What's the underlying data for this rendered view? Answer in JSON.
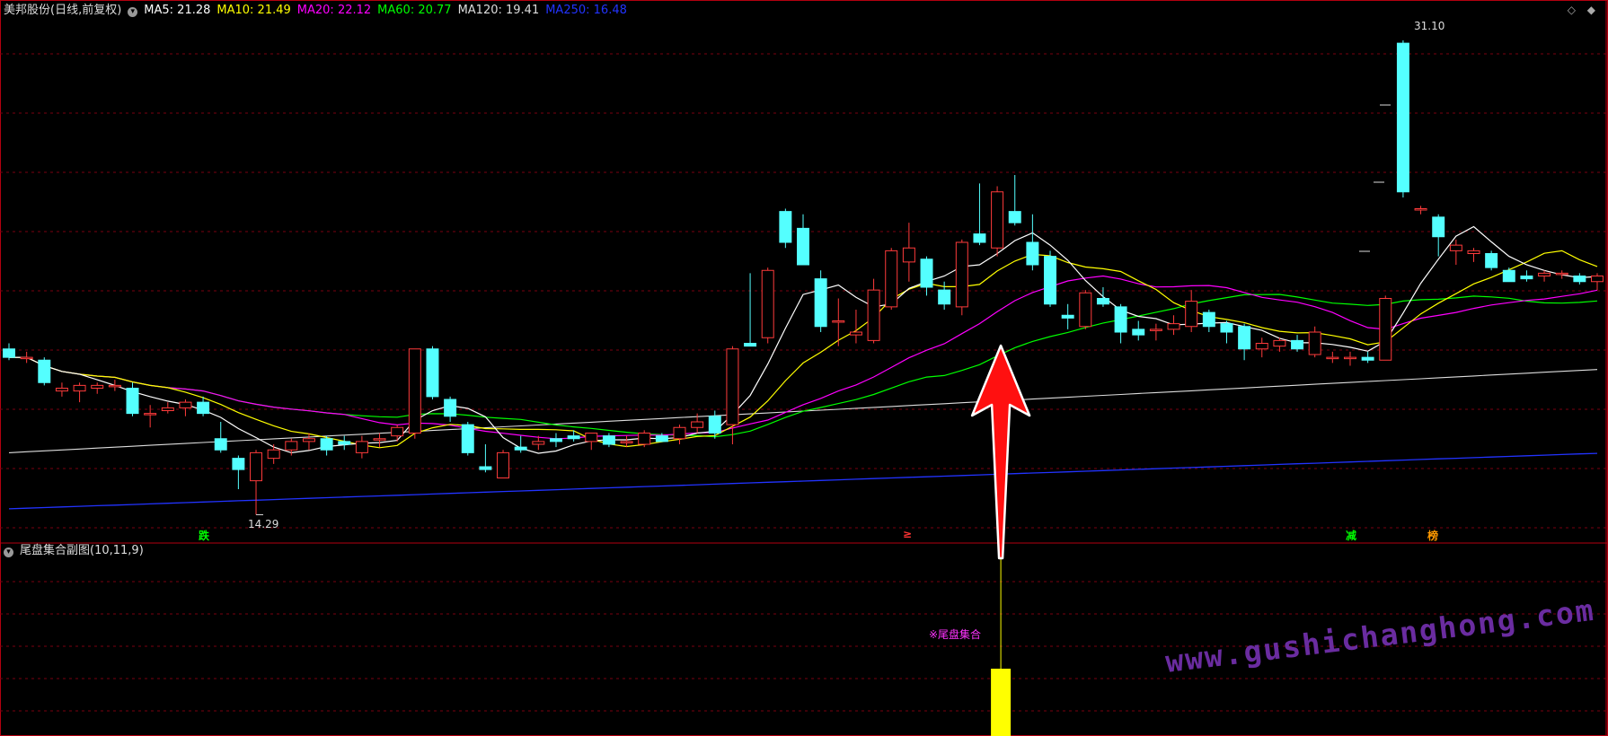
{
  "stock": {
    "title": "美邦股份(日线,前复权)"
  },
  "ma_legend": [
    {
      "label": "MA5: 21.28",
      "color": "#ffffff"
    },
    {
      "label": "MA10: 21.49",
      "color": "#ffff00"
    },
    {
      "label": "MA20: 22.12",
      "color": "#ff00ff"
    },
    {
      "label": "MA60: 20.77",
      "color": "#00ff00"
    },
    {
      "label": "MA120: 19.41",
      "color": "#dddddd"
    },
    {
      "label": "MA250: 16.48",
      "color": "#2233ff"
    }
  ],
  "price_labels": {
    "high": "31.10",
    "low": "14.29"
  },
  "signal_markers": [
    {
      "text": "跌",
      "color": "#00ff00"
    },
    {
      "text": "≥",
      "color": "#ff3333"
    },
    {
      "text": "减",
      "color": "#00ff00"
    },
    {
      "text": "榜",
      "color": "#ff9900"
    }
  ],
  "sub_panel": {
    "title": "尾盘集合副图(10,11,9)",
    "signal_label": "※尾盘集合"
  },
  "watermark": "www.gushichanghong.com",
  "icons": {
    "collapse": "chevron-down-icon",
    "diamond": "diamond-icon"
  },
  "chart_data": {
    "type": "candlestick",
    "candles": [
      [
        20.2,
        20.4,
        19.8,
        19.9
      ],
      [
        19.9,
        20.1,
        19.7,
        19.9
      ],
      [
        19.8,
        19.9,
        18.9,
        19.0
      ],
      [
        18.7,
        19.0,
        18.5,
        18.8
      ],
      [
        18.7,
        19.0,
        18.3,
        18.9
      ],
      [
        18.8,
        19.0,
        18.6,
        18.9
      ],
      [
        18.9,
        19.1,
        18.7,
        18.9
      ],
      [
        18.8,
        19.0,
        17.8,
        17.9
      ],
      [
        17.9,
        18.2,
        17.4,
        17.9
      ],
      [
        18.0,
        18.3,
        17.9,
        18.1
      ],
      [
        18.1,
        18.4,
        17.8,
        18.3
      ],
      [
        18.3,
        18.5,
        17.8,
        17.9
      ],
      [
        17.0,
        17.6,
        16.5,
        16.6
      ],
      [
        16.3,
        16.4,
        15.2,
        15.9
      ],
      [
        15.5,
        16.6,
        14.29,
        16.5
      ],
      [
        16.3,
        16.8,
        16.1,
        16.6
      ],
      [
        16.6,
        17.0,
        16.4,
        16.9
      ],
      [
        16.9,
        17.2,
        16.6,
        17.0
      ],
      [
        17.0,
        17.1,
        16.4,
        16.6
      ],
      [
        16.9,
        17.1,
        16.6,
        16.8
      ],
      [
        16.5,
        17.1,
        16.3,
        16.9
      ],
      [
        17.0,
        17.2,
        16.7,
        17.0
      ],
      [
        17.1,
        17.5,
        16.9,
        17.4
      ],
      [
        17.2,
        20.2,
        17.0,
        20.2
      ],
      [
        20.2,
        20.3,
        18.4,
        18.5
      ],
      [
        18.4,
        18.5,
        17.6,
        17.8
      ],
      [
        17.5,
        17.6,
        16.4,
        16.5
      ],
      [
        16.0,
        16.8,
        15.8,
        15.9
      ],
      [
        15.6,
        16.6,
        15.6,
        16.5
      ],
      [
        16.7,
        17.1,
        16.5,
        16.6
      ],
      [
        16.8,
        17.1,
        16.6,
        16.9
      ],
      [
        17.0,
        17.2,
        16.7,
        16.9
      ],
      [
        17.1,
        17.3,
        16.9,
        17.0
      ],
      [
        16.9,
        17.2,
        16.6,
        17.2
      ],
      [
        17.1,
        17.2,
        16.7,
        16.8
      ],
      [
        16.9,
        17.1,
        16.7,
        16.9
      ],
      [
        16.8,
        17.3,
        16.7,
        17.2
      ],
      [
        17.1,
        17.2,
        16.9,
        16.9
      ],
      [
        17.0,
        17.5,
        16.8,
        17.4
      ],
      [
        17.4,
        17.9,
        17.2,
        17.6
      ],
      [
        17.8,
        18.0,
        17.0,
        17.2
      ],
      [
        17.5,
        20.3,
        16.8,
        20.2
      ],
      [
        20.4,
        22.9,
        20.3,
        20.3
      ],
      [
        20.6,
        23.1,
        20.4,
        23.0
      ],
      [
        25.1,
        25.2,
        23.8,
        24.0
      ],
      [
        24.5,
        25.0,
        23.2,
        23.2
      ],
      [
        22.7,
        23.0,
        20.8,
        21.0
      ],
      [
        21.2,
        22.0,
        20.3,
        21.2
      ],
      [
        20.7,
        21.6,
        20.4,
        20.8
      ],
      [
        20.5,
        22.7,
        20.4,
        22.3
      ],
      [
        21.7,
        23.8,
        21.6,
        23.7
      ],
      [
        23.3,
        24.7,
        22.6,
        23.8
      ],
      [
        23.4,
        23.5,
        22.1,
        22.4
      ],
      [
        22.3,
        22.6,
        21.6,
        21.8
      ],
      [
        21.7,
        24.1,
        21.4,
        24.0
      ],
      [
        24.3,
        26.1,
        23.9,
        24.0
      ],
      [
        23.8,
        26.0,
        23.5,
        25.8
      ],
      [
        25.1,
        26.4,
        24.6,
        24.7
      ],
      [
        24.0,
        25.0,
        23.0,
        23.2
      ],
      [
        23.5,
        23.7,
        21.7,
        21.8
      ],
      [
        21.4,
        21.8,
        20.9,
        21.3
      ],
      [
        21.0,
        22.3,
        20.9,
        22.2
      ],
      [
        22.0,
        22.4,
        21.7,
        21.8
      ],
      [
        21.7,
        21.8,
        20.4,
        20.8
      ],
      [
        20.9,
        21.2,
        20.5,
        20.7
      ],
      [
        20.9,
        21.1,
        20.5,
        20.9
      ],
      [
        20.9,
        21.4,
        20.7,
        21.1
      ],
      [
        21.0,
        22.3,
        20.8,
        21.9
      ],
      [
        21.5,
        21.6,
        20.8,
        21.0
      ],
      [
        21.1,
        21.2,
        20.4,
        20.8
      ],
      [
        21.0,
        21.1,
        19.8,
        20.2
      ],
      [
        20.2,
        20.6,
        19.9,
        20.4
      ],
      [
        20.3,
        20.6,
        20.1,
        20.5
      ],
      [
        20.5,
        20.7,
        20.1,
        20.2
      ],
      [
        20.0,
        21.0,
        19.9,
        20.8
      ],
      [
        19.9,
        20.1,
        19.7,
        19.9
      ],
      [
        19.9,
        20.1,
        19.6,
        19.9
      ],
      [
        19.9,
        20.1,
        19.7,
        19.8
      ],
      [
        19.8,
        22.1,
        19.8,
        22.0
      ],
      [
        31.1,
        31.2,
        25.6,
        25.8
      ],
      [
        25.2,
        25.3,
        25.0,
        25.2
      ],
      [
        24.9,
        25.0,
        23.5,
        24.2
      ],
      [
        23.7,
        24.1,
        23.2,
        23.9
      ],
      [
        23.6,
        23.8,
        23.3,
        23.7
      ],
      [
        23.6,
        23.7,
        23.0,
        23.1
      ],
      [
        23.0,
        23.1,
        22.6,
        22.6
      ],
      [
        22.8,
        23.0,
        22.6,
        22.7
      ],
      [
        22.8,
        23.0,
        22.6,
        22.9
      ],
      [
        22.9,
        23.0,
        22.7,
        22.9
      ],
      [
        22.8,
        22.9,
        22.5,
        22.6
      ],
      [
        22.6,
        22.9,
        22.3,
        22.8
      ]
    ],
    "ylim": [
      13.6,
      32.0
    ],
    "highlight_bar_index": 56
  }
}
